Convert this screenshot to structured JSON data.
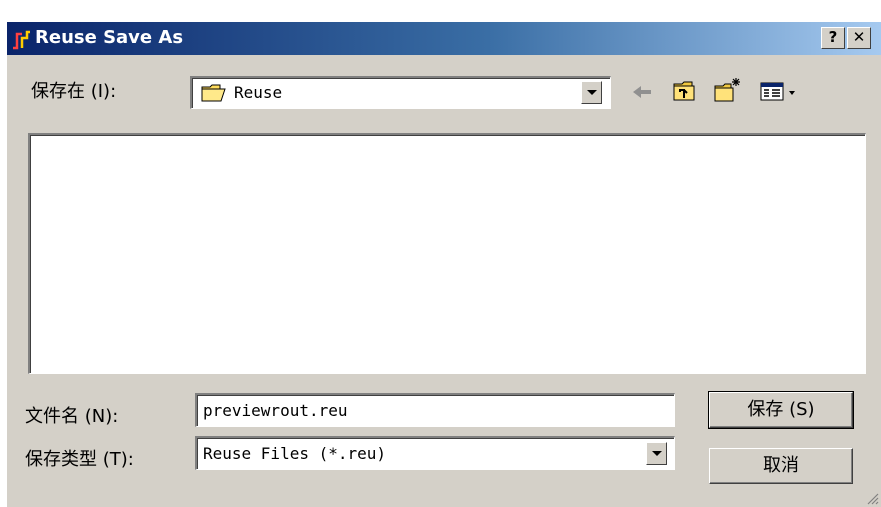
{
  "window": {
    "title": "Reuse Save As",
    "help_button": "?",
    "close_button": "✕"
  },
  "save_in": {
    "label": "保存在 (I):",
    "value": "Reuse"
  },
  "toolbar": {
    "icons": [
      "back-arrow-icon",
      "up-folder-icon",
      "new-folder-icon",
      "view-menu-icon"
    ]
  },
  "file_name": {
    "label": "文件名 (N):",
    "value": "previewrout.reu"
  },
  "file_type": {
    "label": "保存类型 (T):",
    "value": "Reuse Files (*.reu)"
  },
  "buttons": {
    "save": "保存 (S)",
    "cancel": "取消"
  },
  "colors": {
    "title_start": "#0a246a",
    "title_end": "#a6caf0",
    "face": "#d4d0c8"
  }
}
